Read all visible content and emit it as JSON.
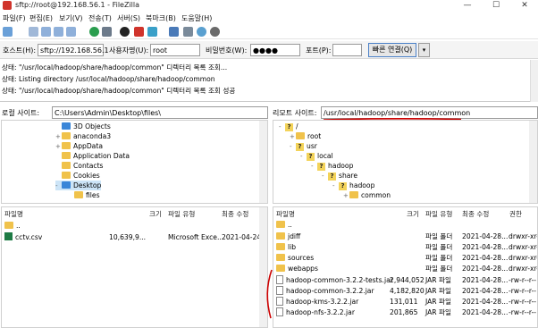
{
  "window": {
    "title": "sftp://root@192.168.56.1 - FileZilla",
    "controls": [
      "—",
      "☐",
      "✕"
    ]
  },
  "menu": [
    "파일(F)",
    "편집(E)",
    "보기(V)",
    "전송(T)",
    "서버(S)",
    "북마크(B)",
    "도움말(H)"
  ],
  "quickconnect": {
    "host_label": "호스트(H):",
    "host_value": "sftp://192.168.56.1",
    "user_label": "사용자명(U):",
    "user_value": "root",
    "pass_label": "비밀번호(W):",
    "pass_value": "●●●●",
    "port_label": "포트(P):",
    "port_value": "",
    "connect_label": "빠른 연결(Q)",
    "dropdown": "▾"
  },
  "log": [
    "상태:  \"/usr/local/hadoop/share/hadoop/common\" 디렉터리 목록 조회...",
    "상태:  Listing directory /usr/local/hadoop/share/hadoop/common",
    "상태:  \"/usr/local/hadoop/share/hadoop/common\" 디렉터리 목록 조회 성공"
  ],
  "local": {
    "site_label": "로컬 사이트:",
    "site_path": "C:\\Users\\Admin\\Desktop\\files\\",
    "tree": [
      {
        "label": "3D Objects",
        "icon": "blue",
        "exp": ""
      },
      {
        "label": "anaconda3",
        "icon": "folder",
        "exp": "+"
      },
      {
        "label": "AppData",
        "icon": "folder",
        "exp": "+"
      },
      {
        "label": "Application Data",
        "icon": "folder",
        "exp": ""
      },
      {
        "label": "Contacts",
        "icon": "folder",
        "exp": ""
      },
      {
        "label": "Cookies",
        "icon": "folder",
        "exp": ""
      },
      {
        "label": "Desktop",
        "icon": "blue",
        "exp": "-"
      },
      {
        "label": "files",
        "icon": "folder",
        "exp": ""
      }
    ],
    "columns": [
      "파일명",
      "크기",
      "파일 유형",
      "최종 수정"
    ],
    "files": [
      {
        "name": "..",
        "size": "",
        "type": "",
        "modified": ""
      },
      {
        "name": "cctv.csv",
        "size": "10,639,9...",
        "type": "Microsoft Exce...",
        "modified": "2021-04-24 오..."
      }
    ]
  },
  "remote": {
    "site_label": "리모트 사이트:",
    "site_path": "/usr/local/hadoop/share/hadoop/common",
    "tree": [
      {
        "label": "/",
        "icon": "q",
        "exp": "-"
      },
      {
        "label": "root",
        "icon": "folder",
        "exp": "+"
      },
      {
        "label": "usr",
        "icon": "q",
        "exp": "-"
      },
      {
        "label": "local",
        "icon": "q",
        "exp": "-"
      },
      {
        "label": "hadoop",
        "icon": "q",
        "exp": "-"
      },
      {
        "label": "share",
        "icon": "q",
        "exp": "-"
      },
      {
        "label": "hadoop",
        "icon": "q",
        "exp": "-"
      },
      {
        "label": "common",
        "icon": "folder",
        "exp": "+"
      }
    ],
    "columns": [
      "파일명",
      "크기",
      "파일 유형",
      "최종 수정",
      "권한"
    ],
    "files": [
      {
        "name": "..",
        "size": "",
        "type": "",
        "modified": "",
        "perm": "",
        "kind": "folder"
      },
      {
        "name": "jdiff",
        "size": "",
        "type": "파일 폴더",
        "modified": "2021-04-28...",
        "perm": "drwxr-xr-",
        "kind": "folder"
      },
      {
        "name": "lib",
        "size": "",
        "type": "파일 폴더",
        "modified": "2021-04-28...",
        "perm": "drwxr-xr-",
        "kind": "folder"
      },
      {
        "name": "sources",
        "size": "",
        "type": "파일 폴더",
        "modified": "2021-04-28...",
        "perm": "drwxr-xr-",
        "kind": "folder"
      },
      {
        "name": "webapps",
        "size": "",
        "type": "파일 폴더",
        "modified": "2021-04-28...",
        "perm": "drwxr-xr-",
        "kind": "folder"
      },
      {
        "name": "hadoop-common-3.2.2-tests.jar",
        "size": "2,944,052",
        "type": "JAR 파일",
        "modified": "2021-04-28...",
        "perm": "-rw-r--r--",
        "kind": "file"
      },
      {
        "name": "hadoop-common-3.2.2.jar",
        "size": "4,182,820",
        "type": "JAR 파일",
        "modified": "2021-04-28...",
        "perm": "-rw-r--r--",
        "kind": "file"
      },
      {
        "name": "hadoop-kms-3.2.2.jar",
        "size": "131,011",
        "type": "JAR 파일",
        "modified": "2021-04-28...",
        "perm": "-rw-r--r--",
        "kind": "file"
      },
      {
        "name": "hadoop-nfs-3.2.2.jar",
        "size": "201,865",
        "type": "JAR 파일",
        "modified": "2021-04-28...",
        "perm": "-rw-r--r--",
        "kind": "file"
      }
    ]
  },
  "colors": {
    "folder": "#f0c24b",
    "annotation": "#cc0000",
    "accent": "#4a80c8"
  }
}
